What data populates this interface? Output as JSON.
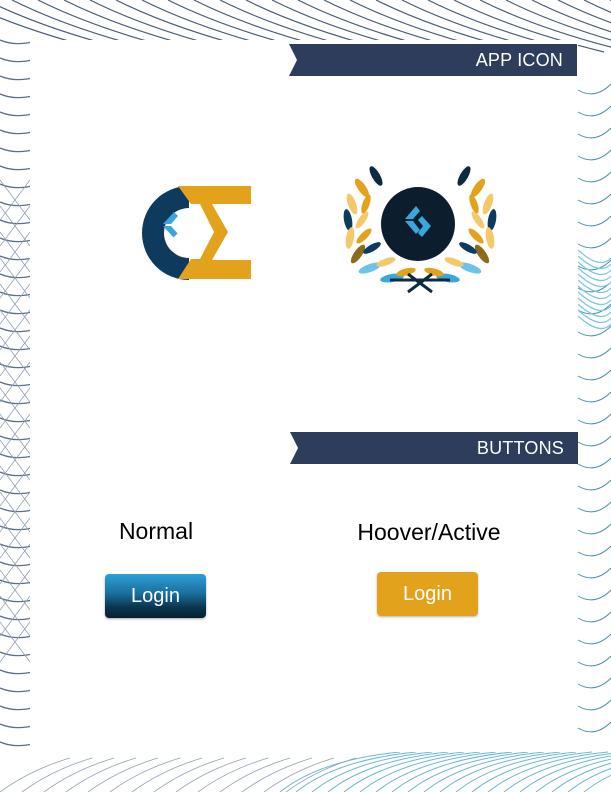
{
  "sections": {
    "app_icon_title": "APP ICON",
    "buttons_title": "BUTTONS"
  },
  "buttons": {
    "normal_label": "Normal",
    "hover_label": "Hoover/Active",
    "login_normal": "Login",
    "login_hover": "Login"
  },
  "colors": {
    "navy": "#2e3d5c",
    "dark_blue": "#0e3a5e",
    "gold": "#e3a21c",
    "light_blue": "#3aa6dc",
    "light_gold": "#f4c96b"
  },
  "icons": [
    "ce-logo-icon",
    "laurel-wreath-icon",
    "chevron-diamond-icon"
  ]
}
